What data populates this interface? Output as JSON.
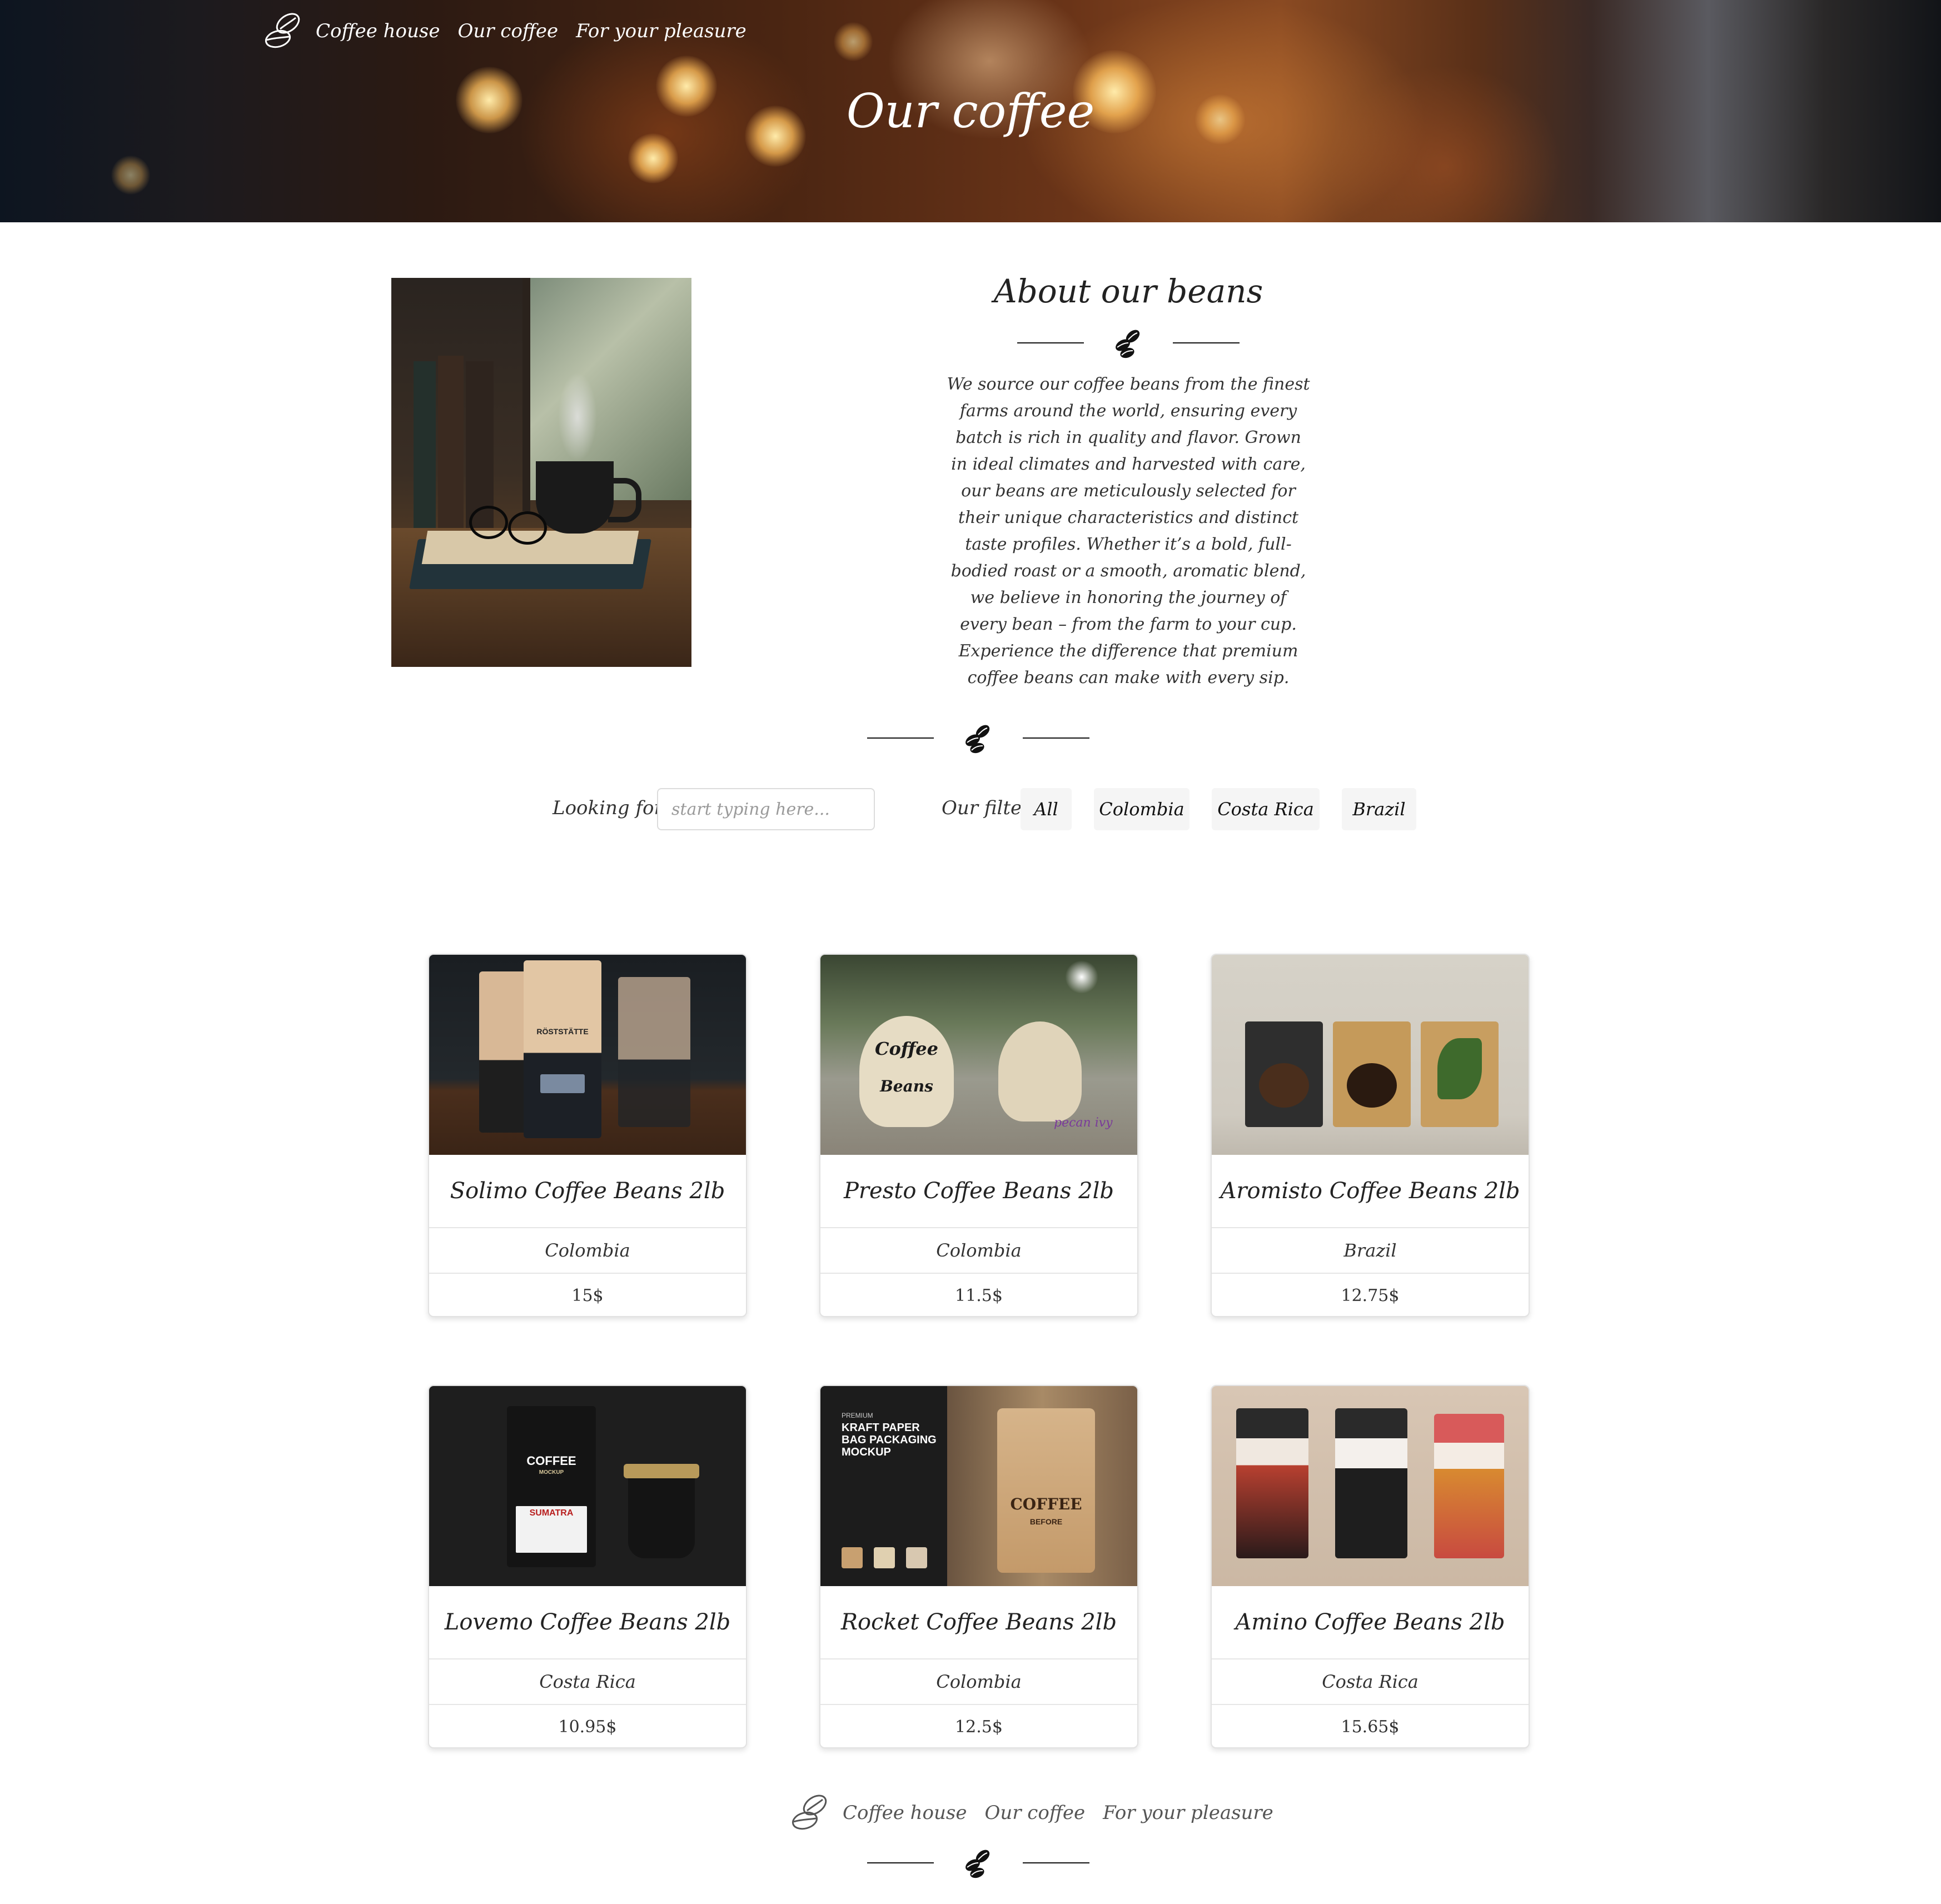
{
  "nav": {
    "logo_icon": "coffee-beans-outline-icon",
    "links": [
      "Coffee house",
      "Our coffee",
      "For your pleasure"
    ]
  },
  "hero": {
    "title": "Our coffee"
  },
  "about": {
    "title": "About our beans",
    "text": "We source our coffee beans from the finest farms around the world, ensuring every batch is rich in quality and flavor. Grown in ideal climates and harvested with care, our beans are meticulously selected for their unique characteristics and distinct taste profiles. Whether it’s a bold, full-bodied roast or a smooth, aromatic blend, we believe in honoring the journey of every bean – from the farm to your cup. Experience the difference that premium coffee beans can make with every sip."
  },
  "search": {
    "label": "Looking for",
    "placeholder": "start typing here...",
    "value": ""
  },
  "filter": {
    "label": "Our filter",
    "options": [
      "All",
      "Colombia",
      "Costa Rica",
      "Brazil"
    ]
  },
  "products": [
    {
      "name": "Solimo Coffee Beans 2lb",
      "country": "Colombia",
      "price": "15$"
    },
    {
      "name": "Presto Coffee Beans 2lb",
      "country": "Colombia",
      "price": "11.5$"
    },
    {
      "name": "Aromisto Coffee Beans 2lb",
      "country": "Brazil",
      "price": "12.75$"
    },
    {
      "name": "Lovemo Coffee Beans 2lb",
      "country": "Costa Rica",
      "price": "10.95$"
    },
    {
      "name": "Rocket Coffee Beans 2lb",
      "country": "Colombia",
      "price": "12.5$"
    },
    {
      "name": "Amino Coffee Beans 2lb",
      "country": "Costa Rica",
      "price": "15.65$"
    }
  ],
  "product_images": {
    "p1": {
      "brand": "RÖSTSTÄTTE"
    },
    "p2": {
      "line1": "Coffee",
      "line2": "Beans",
      "watermark": "pecan ivy"
    },
    "p4": {
      "brand": "COFFEE",
      "sub": "MOCKUP",
      "origin": "SUMATRA"
    },
    "p5": {
      "premium": "PREMIUM",
      "headline": "KRAFT PAPER BAG PACKAGING MOCKUP",
      "bag": "COFFEE",
      "bag_sub": "BEFORE"
    }
  },
  "footer": {
    "logo_icon": "coffee-beans-outline-icon",
    "links": [
      "Coffee house",
      "Our coffee",
      "For your pleasure"
    ]
  },
  "icons": {
    "divider": "coffee-beans-icon"
  },
  "colors": {
    "hero_text": "#ffffff",
    "footer_link": "#555555",
    "filter_bg": "#f5f5f5",
    "card_border": "#e2e2e2"
  }
}
